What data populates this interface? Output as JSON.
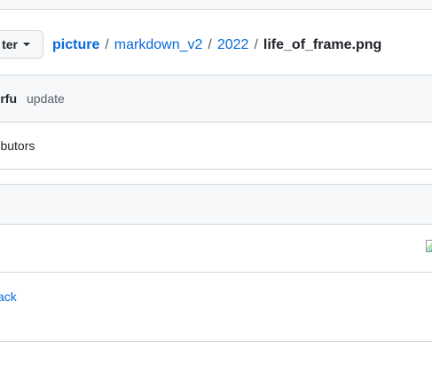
{
  "branch": {
    "label": "ter"
  },
  "breadcrumb": {
    "repo": "picture",
    "folders": [
      "markdown_v2",
      "2022"
    ],
    "separator": "/",
    "file": "life_of_frame.png"
  },
  "commit": {
    "author": "perfu",
    "message": "update"
  },
  "contributors": {
    "text": "ntributors"
  },
  "file_view": {
    "image_icon": "broken-image-icon"
  },
  "footer": {
    "back_link": "ack"
  },
  "colors": {
    "link": "#0969da",
    "border": "#d0d7de",
    "muted_bg": "#f6f8fa"
  }
}
